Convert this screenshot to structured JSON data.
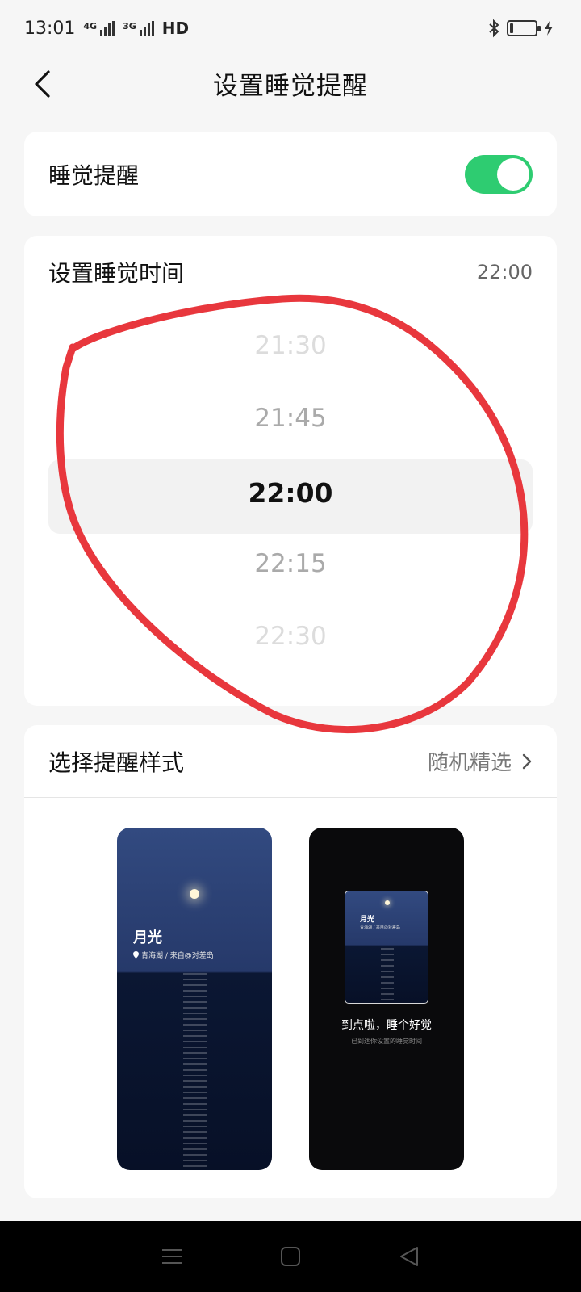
{
  "status_bar": {
    "time": "13:01",
    "network_4g": "4G",
    "network_3g": "3G",
    "hd": "HD",
    "battery_level": 0.12,
    "icons": [
      "signal-icon",
      "bluetooth-icon",
      "battery-icon",
      "charging-icon"
    ]
  },
  "header": {
    "title": "设置睡觉提醒",
    "back_icon": "back-arrow-icon"
  },
  "sleep_reminder": {
    "label": "睡觉提醒",
    "enabled": true,
    "toggle_color": "#2ecc71"
  },
  "sleep_time": {
    "label": "设置睡觉时间",
    "value": "22:00",
    "picker_options": [
      "21:30",
      "21:45",
      "22:00",
      "22:15",
      "22:30"
    ],
    "selected": "22:00"
  },
  "reminder_style": {
    "label": "选择提醒样式",
    "value": "随机精选",
    "chevron_icon": "chevron-right-icon",
    "preview1": {
      "title": "月光",
      "subtitle": "青海湖 / 来自@对差岛"
    },
    "preview2": {
      "inner_title": "月光",
      "inner_subtitle": "青海湖 / 来自@对差岛",
      "message": "到点啦，睡个好觉",
      "sub_message": "已到达你设置的睡觉时间"
    }
  },
  "nav_bar": {
    "icons": [
      "menu-icon",
      "home-icon",
      "back-icon"
    ]
  },
  "annotation_color": "#e8373d"
}
